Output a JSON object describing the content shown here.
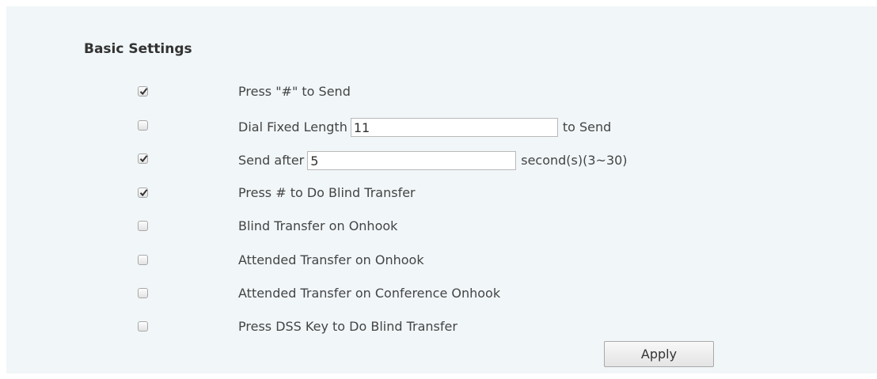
{
  "section": {
    "title": "Basic Settings"
  },
  "options": [
    {
      "label": "Press \"#\" to Send",
      "checked": true
    },
    {
      "label_before": "Dial Fixed Length",
      "input_value": "11",
      "label_after": "to Send",
      "checked": false
    },
    {
      "label_before": "Send after",
      "input_value": "5",
      "label_after": "second(s)(3~30)",
      "checked": true
    },
    {
      "label": "Press # to Do Blind Transfer",
      "checked": true
    },
    {
      "label": "Blind Transfer on Onhook",
      "checked": false
    },
    {
      "label": "Attended Transfer on Onhook",
      "checked": false
    },
    {
      "label": "Attended Transfer on Conference Onhook",
      "checked": false
    },
    {
      "label": "Press DSS Key to Do Blind Transfer",
      "checked": false
    }
  ],
  "buttons": {
    "apply_label": "Apply"
  },
  "icons": {
    "check": "checkmark-icon"
  },
  "colors": {
    "panel_background": "#f1f6f8",
    "text": "#444444"
  }
}
